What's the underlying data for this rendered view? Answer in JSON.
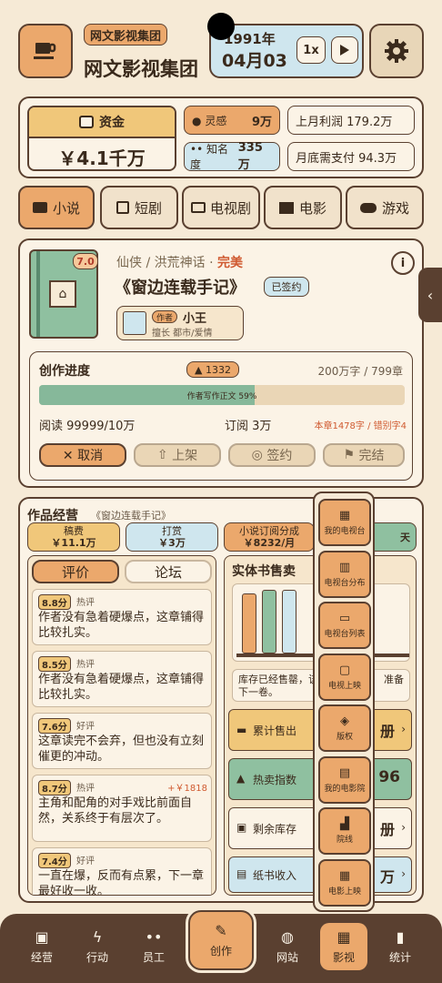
{
  "header": {
    "company_tag": "网文影视集团",
    "company_name": "网文影视集团",
    "year": "1991年",
    "date": "04月03",
    "speed": "1x"
  },
  "stats": {
    "funds_label": "资金",
    "funds_value": "￥4.1千万",
    "inspiration_label": "灵感",
    "inspiration_value": "9万",
    "fame_label": "知名度",
    "fame_value": "335万",
    "last_month_profit": "上月利润 179.2万",
    "month_end_pay": "月底需支付 94.3万"
  },
  "tabs": [
    {
      "label": "小说"
    },
    {
      "label": "短剧"
    },
    {
      "label": "电视剧"
    },
    {
      "label": "电影"
    },
    {
      "label": "游戏"
    }
  ],
  "novel": {
    "score": "7.0",
    "genre": "仙侠 / 洪荒神话 · ",
    "status": "完美",
    "title": "《窗边连载手记》",
    "signed_badge": "已签约",
    "author_tag": "作者",
    "author_name": "小王",
    "author_specialty": "擅长 都市/爱情"
  },
  "progress": {
    "title": "创作进度",
    "fire_count": "1332",
    "words": "200万字 / 799章",
    "bar_label": "作者写作正文 59%",
    "bar_fraction": 0.59,
    "reads": "阅读 99999/10万",
    "subscribe": "订阅 3万",
    "chapter_errors": "本章1478字 / 错别字4",
    "cancel": "✕ 取消",
    "publish": "上架",
    "sign": "签约",
    "finish": "完结"
  },
  "ops": {
    "title": "作品经营",
    "subtitle": "《窗边连载手记》",
    "chips": [
      {
        "top": "稿费",
        "bottom": "￥11.1万"
      },
      {
        "top": "打赏",
        "bottom": "￥3万"
      },
      {
        "top": "小说订阅分成",
        "bottom": "￥8232/月"
      },
      {
        "top": "",
        "bottom": "天"
      }
    ]
  },
  "reviews": {
    "tab_review": "评价",
    "tab_forum": "论坛",
    "items": [
      {
        "score": "8.8分",
        "tag": "热评",
        "reward": "",
        "text": "作者没有急着硬爆点，这章铺得比较扎实。"
      },
      {
        "score": "8.5分",
        "tag": "热评",
        "reward": "",
        "text": "作者没有急着硬爆点，这章铺得比较扎实。"
      },
      {
        "score": "7.6分",
        "tag": "好评",
        "reward": "",
        "text": "这章读完不会弃，但也没有立刻催更的冲动。"
      },
      {
        "score": "8.7分",
        "tag": "热评",
        "reward": "+￥1818",
        "text": "主角和配角的对手戏比前面自然，关系终于有层次了。"
      },
      {
        "score": "7.4分",
        "tag": "好评",
        "reward": "",
        "text": "一直在爆，反而有点累，下一章最好收一收。"
      }
    ]
  },
  "physical": {
    "title": "实体书售卖",
    "stock_note": "库存已经售罄，该",
    "stock_note2": "下一卷。",
    "stock_note_right": "准备",
    "rows": [
      {
        "label": "累计售出",
        "value": "册"
      },
      {
        "label": "热卖指数",
        "value": "96"
      },
      {
        "label": "剩余库存",
        "value": "册"
      },
      {
        "label": "纸书收入",
        "value": "万"
      }
    ]
  },
  "tv_menu": {
    "items": [
      {
        "label": "我的电视台",
        "icon": "building-icon"
      },
      {
        "label": "电视台分布",
        "icon": "map-icon"
      },
      {
        "label": "电视台列表",
        "icon": "tv-icon"
      },
      {
        "label": "电视上映",
        "icon": "screen-icon"
      },
      {
        "label": "版权",
        "icon": "handshake-icon"
      },
      {
        "label": "我的电影院",
        "icon": "cinema-icon"
      },
      {
        "label": "院线",
        "icon": "chair-icon"
      },
      {
        "label": "电影上映",
        "icon": "film-icon"
      }
    ]
  },
  "bottom_nav": [
    {
      "label": "经营"
    },
    {
      "label": "行动"
    },
    {
      "label": "员工"
    },
    {
      "label": "创作"
    },
    {
      "label": "网站"
    },
    {
      "label": "影视"
    },
    {
      "label": "统计"
    }
  ]
}
